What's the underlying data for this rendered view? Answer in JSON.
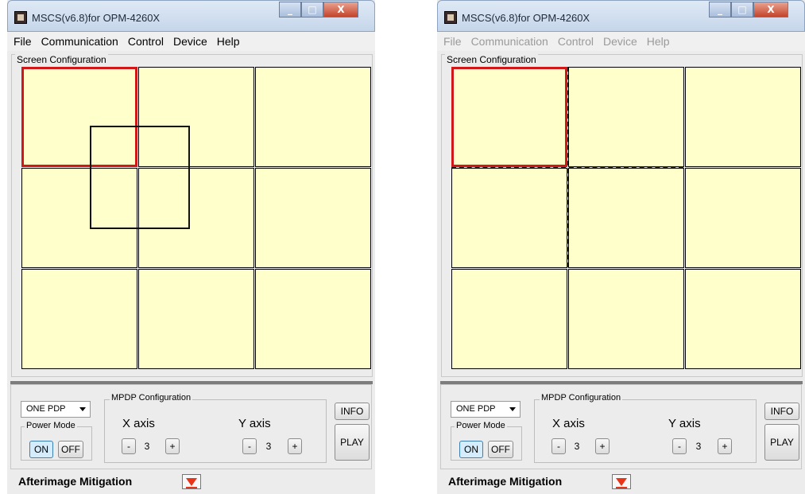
{
  "windows": [
    {
      "title": "MSCS(v6.8)for OPM-4260X",
      "menu": {
        "items": [
          "File",
          "Communication",
          "Control",
          "Device",
          "Help"
        ],
        "disabled": false
      },
      "screen_config_label": "Screen Configuration",
      "one_pdp_value": "ONE PDP",
      "power_mode_label": "Power Mode",
      "on_label": "ON",
      "off_label": "OFF",
      "mpdp_label": "MPDP Configuration",
      "x_axis_label": "X axis",
      "y_axis_label": "Y axis",
      "minus_label": "-",
      "plus_label": "+",
      "x_value": "3",
      "y_value": "3",
      "info_label": "INFO",
      "play_label": "PLAY",
      "afterimage_label": "Afterimage  Mitigation"
    },
    {
      "title": "MSCS(v6.8)for OPM-4260X",
      "menu": {
        "items": [
          "File",
          "Communication",
          "Control",
          "Device",
          "Help"
        ],
        "disabled": true
      },
      "screen_config_label": "Screen Configuration",
      "one_pdp_value": "ONE PDP",
      "power_mode_label": "Power Mode",
      "on_label": "ON",
      "off_label": "OFF",
      "mpdp_label": "MPDP Configuration",
      "x_axis_label": "X axis",
      "y_axis_label": "Y axis",
      "minus_label": "-",
      "plus_label": "+",
      "x_value": "3",
      "y_value": "3",
      "info_label": "INFO",
      "play_label": "PLAY",
      "afterimage_label": "Afterimage  Mitigation"
    }
  ],
  "colors": {
    "cell_fill": "#ffffcc",
    "selection": "#d01818",
    "afterimage_icon": "#e8351a"
  },
  "icons": {
    "minimize": "minimize-icon",
    "maximize": "maximize-icon",
    "close": "close-icon",
    "dropdown": "chevron-down-icon",
    "afterimage_toggle": "triangle-down-icon"
  }
}
